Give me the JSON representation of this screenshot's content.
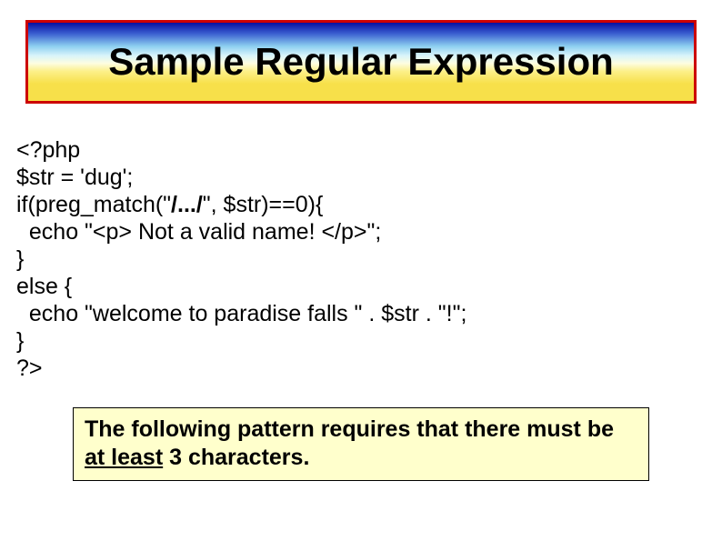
{
  "title": "Sample Regular Expression",
  "code": {
    "l1": "<?php",
    "l2": "$str = 'dug';",
    "l3a": "if(preg_match(\"",
    "l3b": "/.../",
    "l3c": "\", $str)==0){",
    "l4": "  echo \"<p> Not a valid name! </p>\";",
    "l5": "}",
    "l6": "else {",
    "l7": "  echo \"welcome to paradise falls \" . $str . \"!\";",
    "l8": "}",
    "l9": "?>"
  },
  "caption": {
    "pre": "The following pattern requires that there must be ",
    "underlined": "at least",
    "post": " 3 characters."
  }
}
